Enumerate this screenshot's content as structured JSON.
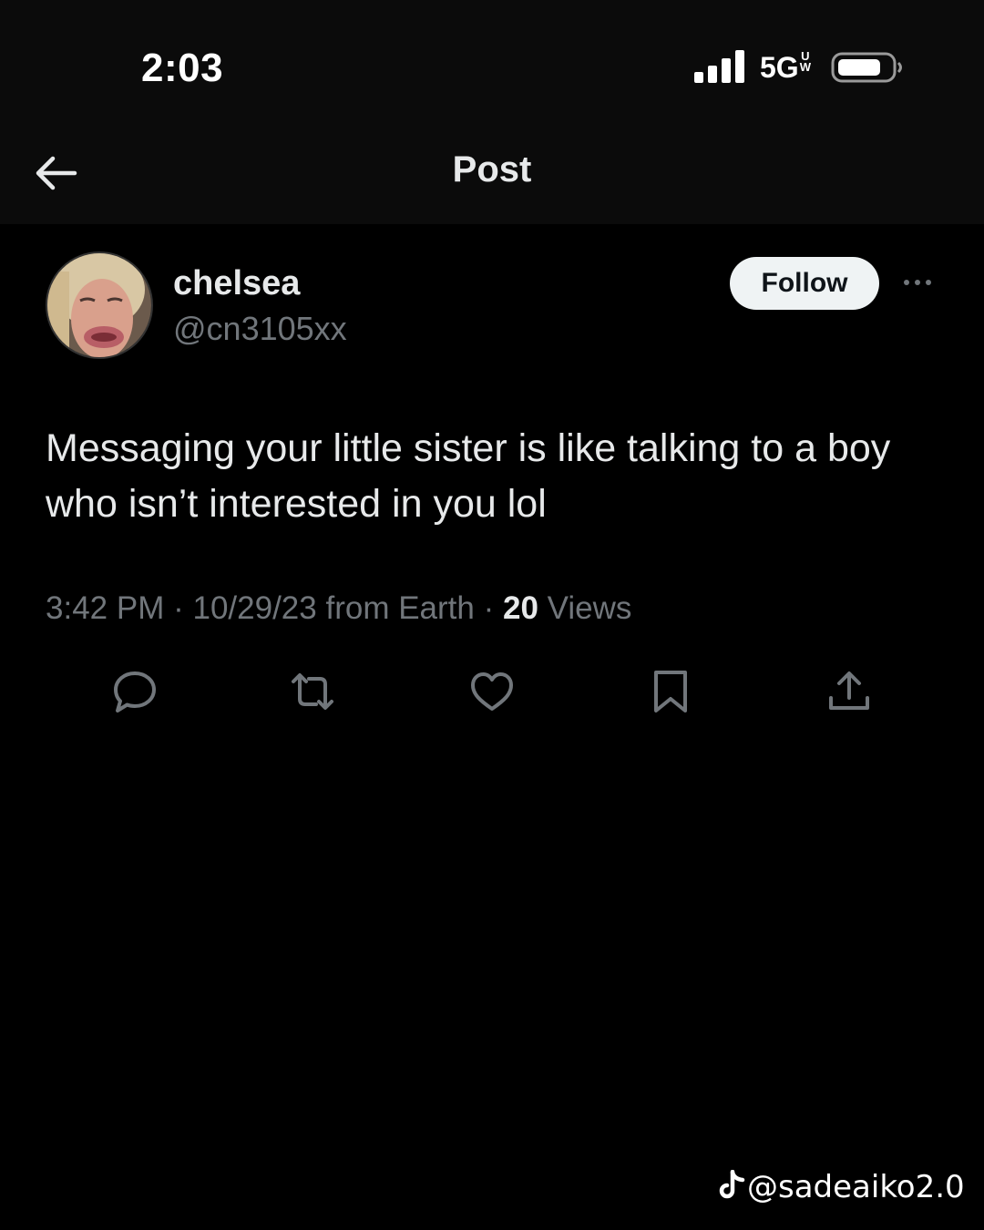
{
  "status_bar": {
    "time": "2:03",
    "network": "5G",
    "network_sub_top": "U",
    "network_sub_bottom": "W",
    "icons": [
      "signal-icon",
      "battery-icon"
    ]
  },
  "header": {
    "title": "Post",
    "back_icon": "arrow-left-icon"
  },
  "author": {
    "display_name": "chelsea",
    "handle": "@cn3105xx",
    "follow_label": "Follow",
    "more_icon": "ellipsis-icon"
  },
  "post": {
    "text": "Messaging your little sister is like talking to a boy who isn’t interested in you lol"
  },
  "meta": {
    "time": "3:42 PM",
    "date": "10/29/23",
    "source": "from Earth",
    "views_count": "20",
    "views_label": "Views",
    "separator": "·"
  },
  "actions": [
    "reply-icon",
    "repost-icon",
    "like-icon",
    "bookmark-icon",
    "share-icon"
  ],
  "watermark": {
    "text": "@sadeaiko2.0",
    "icon": "tiktok-icon"
  },
  "colors": {
    "background": "#000000",
    "header_background": "#0b0b0b",
    "primary_text": "#e7e9ea",
    "secondary_text": "#71767b",
    "follow_bg": "#eff3f4"
  }
}
